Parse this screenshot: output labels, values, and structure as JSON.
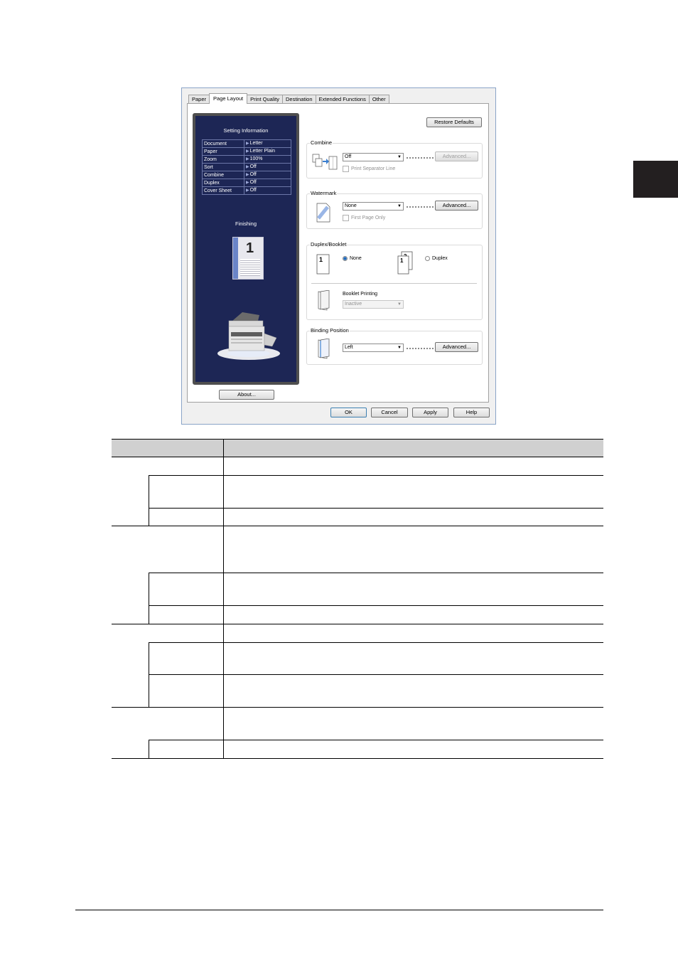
{
  "dialog": {
    "tabs": [
      "Paper",
      "Page Layout",
      "Print Quality",
      "Destination",
      "Extended Functions",
      "Other"
    ],
    "active_tab": "Page Layout",
    "restore_defaults": "Restore Defaults",
    "about": "About...",
    "ok": "OK",
    "cancel": "Cancel",
    "apply": "Apply",
    "help": "Help"
  },
  "setting_info": {
    "title": "Setting Information",
    "rows": [
      {
        "key": "Document",
        "value": "Letter"
      },
      {
        "key": "Paper",
        "value": "Letter Plain"
      },
      {
        "key": "Zoom",
        "value": "100%"
      },
      {
        "key": "Sort",
        "value": "Off"
      },
      {
        "key": "Combine",
        "value": "Off"
      },
      {
        "key": "Duplex",
        "value": "Off"
      },
      {
        "key": "Cover Sheet",
        "value": "Off"
      }
    ],
    "finishing": "Finishing",
    "page_number": "1"
  },
  "combine": {
    "label": "Combine",
    "select": "Off",
    "advanced": "Advanced...",
    "separator": "Print Separator Line"
  },
  "watermark": {
    "label": "Watermark",
    "select": "None",
    "advanced": "Advanced...",
    "first_page": "First Page Only"
  },
  "duplex": {
    "label": "Duplex/Booklet",
    "none": "None",
    "duplex": "Duplex",
    "booklet_label": "Booklet Printing",
    "booklet_select": "Inactive"
  },
  "binding": {
    "label": "Binding Position",
    "select": "Left",
    "advanced": "Advanced..."
  },
  "colors": {
    "info_bg": "#1d2655",
    "table_header": "#d0d0d0"
  }
}
